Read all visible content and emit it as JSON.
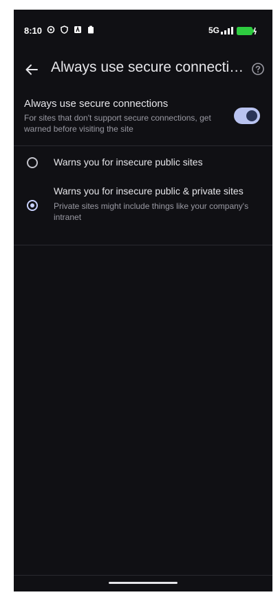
{
  "status_bar": {
    "time": "8:10",
    "network": "5G",
    "icons": [
      "settings-icon",
      "shield-icon",
      "a-icon",
      "clipboard-icon",
      "signal-icon",
      "battery-charging-icon"
    ],
    "battery_color": "#2ecc40"
  },
  "app_bar": {
    "title": "Always use secure connecti…",
    "back_icon": "arrow-left-icon",
    "help_icon": "help-circle-icon"
  },
  "setting": {
    "title": "Always use secure connections",
    "description": "For sites that don't support secure connections, get warned before visiting the site",
    "enabled": true
  },
  "options": [
    {
      "label": "Warns you for insecure public sites",
      "description": "",
      "selected": false
    },
    {
      "label": "Warns you for insecure public & private sites",
      "description": "Private sites might include things like your company's intranet",
      "selected": true
    }
  ],
  "colors": {
    "background": "#101014",
    "accent": "#c9d2ff",
    "toggle_track": "#b9c3f0"
  }
}
